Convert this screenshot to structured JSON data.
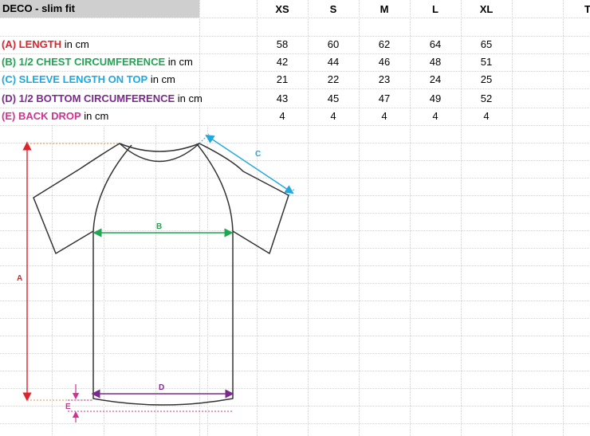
{
  "sheet": {
    "title": "DECO - slim fit",
    "extra_col_header": "T",
    "sizes": [
      "XS",
      "S",
      "M",
      "L",
      "XL"
    ],
    "rows": [
      {
        "key": "(A) LENGTH",
        "unit": " in cm",
        "color": "#e0222b",
        "values": [
          "58",
          "60",
          "62",
          "64",
          "65"
        ]
      },
      {
        "key": "(B) 1/2 CHEST CIRCUMFERENCE",
        "unit": " in cm",
        "color": "#1ea650",
        "values": [
          "42",
          "44",
          "46",
          "48",
          "51"
        ]
      },
      {
        "key": "(C) SLEEVE LENGTH ON TOP",
        "unit": " in cm",
        "color": "#1fa9e0",
        "values": [
          "21",
          "22",
          "23",
          "24",
          "25"
        ]
      },
      {
        "key": "(D) 1/2 BOTTOM CIRCUMFERENCE",
        "unit": " in cm",
        "color": "#7a2a8c",
        "values": [
          "43",
          "45",
          "47",
          "49",
          "52"
        ]
      },
      {
        "key": "(E) BACK DROP",
        "unit": " in cm",
        "color": "#d3308f",
        "values": [
          "4",
          "4",
          "4",
          "4",
          "4"
        ]
      }
    ]
  },
  "diagram": {
    "label_a": "A",
    "label_b": "B",
    "label_c": "C",
    "label_d": "D",
    "label_e": "E",
    "colors": {
      "a": "#e0222b",
      "b": "#1ea650",
      "c": "#1fa9e0",
      "d": "#7a2a8c",
      "e": "#d3308f",
      "outline": "#333333"
    }
  }
}
